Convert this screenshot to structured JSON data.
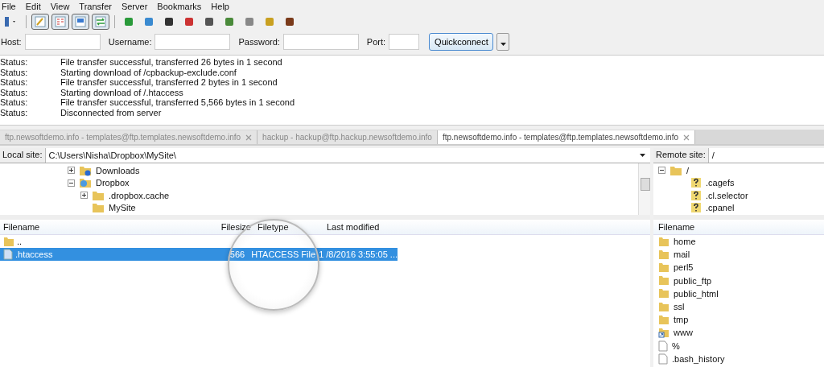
{
  "menu": [
    "File",
    "Edit",
    "View",
    "Transfer",
    "Server",
    "Bookmarks",
    "Help"
  ],
  "toolbar": {
    "toggles": [
      {
        "on": true
      },
      {
        "on": true
      },
      {
        "on": true
      },
      {
        "on": true
      }
    ]
  },
  "quickconnect": {
    "fields": [
      {
        "label": "Host:",
        "kind": "text"
      },
      {
        "label": "Username:",
        "kind": "text"
      },
      {
        "label": "Password:",
        "kind": "text"
      },
      {
        "label": "Port:",
        "kind": "port"
      }
    ],
    "button": "Quickconnect"
  },
  "log": [
    {
      "type": "Status:",
      "message": "File transfer successful, transferred 26 bytes in 1 second"
    },
    {
      "type": "Status:",
      "message": "Starting download of /cpbackup-exclude.conf"
    },
    {
      "type": "Status:",
      "message": "File transfer successful, transferred 2 bytes in 1 second"
    },
    {
      "type": "Status:",
      "message": "Starting download of /.htaccess"
    },
    {
      "type": "Status:",
      "message": "File transfer successful, transferred 5,566 bytes in 1 second"
    },
    {
      "type": "Status:",
      "message": "Disconnected from server"
    }
  ],
  "tabs": [
    {
      "label": "ftp.newsoftdemo.info - templates@ftp.templates.newsoftdemo.info",
      "selected": false
    },
    {
      "label": "hackup - hackup@ftp.hackup.newsoftdemo.info",
      "selected": false
    },
    {
      "label": "ftp.newsoftdemo.info - templates@ftp.templates.newsoftdemo.info",
      "selected": true
    }
  ],
  "local": {
    "label": "Local site:",
    "path": "C:\\Users\\Nisha\\Dropbox\\MySite\\",
    "tree": [
      {
        "name": "Downloads",
        "kind": "downloads",
        "expanded": false
      },
      {
        "name": "Dropbox",
        "kind": "dropbox",
        "expanded": true,
        "children": [
          {
            "name": ".dropbox.cache",
            "kind": "folder",
            "expanded": false
          },
          {
            "name": "MySite",
            "kind": "folder"
          }
        ]
      }
    ],
    "columns": [
      "Filename",
      "Filesize",
      "Filetype",
      "Last modified"
    ],
    "files": [
      {
        "cells": [
          "..",
          "",
          "",
          ""
        ],
        "kind": "folder",
        "selected": false
      },
      {
        "cells": [
          ".htaccess",
          ",566",
          "HTACCESS File",
          "1 /8/2016 3:55:05 ..."
        ],
        "kind": "file",
        "selected": true
      }
    ]
  },
  "remote": {
    "label": "Remote site:",
    "path": "/",
    "tree": [
      {
        "name": "/",
        "kind": "folder",
        "expanded": true,
        "children": [
          {
            "name": ".cagefs",
            "kind": "unknown"
          },
          {
            "name": ".cl.selector",
            "kind": "unknown"
          },
          {
            "name": ".cpanel",
            "kind": "unknown"
          }
        ]
      }
    ],
    "columns": [
      "Filename"
    ],
    "files": [
      {
        "name": "home",
        "kind": "folder"
      },
      {
        "name": "mail",
        "kind": "folder"
      },
      {
        "name": "perl5",
        "kind": "folder"
      },
      {
        "name": "public_ftp",
        "kind": "folder"
      },
      {
        "name": "public_html",
        "kind": "folder"
      },
      {
        "name": "ssl",
        "kind": "folder"
      },
      {
        "name": "tmp",
        "kind": "folder"
      },
      {
        "name": "www",
        "kind": "link"
      },
      {
        "name": "%",
        "kind": "file"
      },
      {
        "name": ".bash_history",
        "kind": "file"
      }
    ]
  }
}
